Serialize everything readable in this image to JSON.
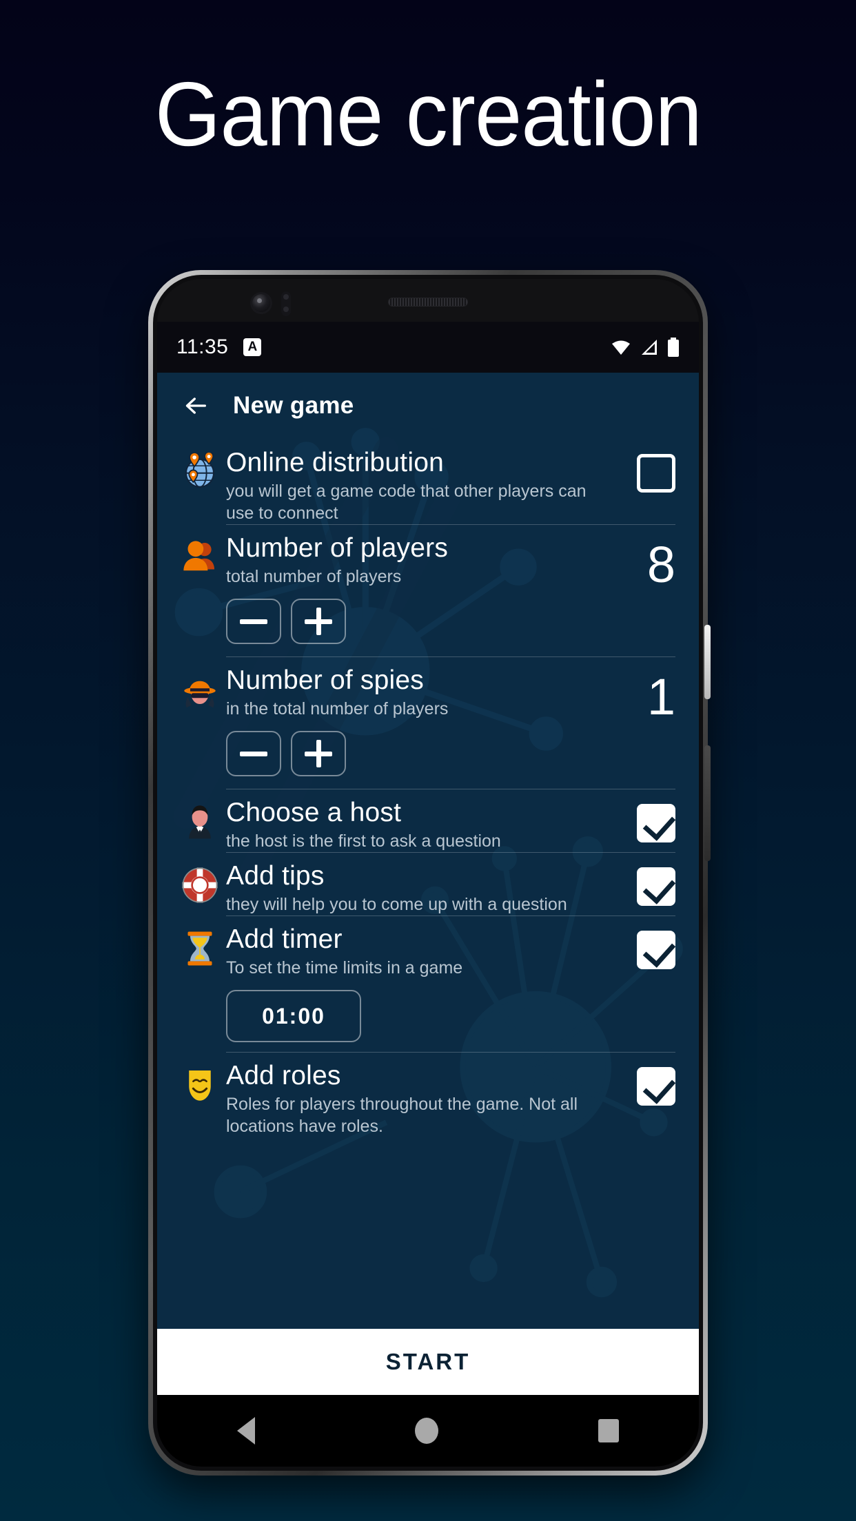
{
  "hero": {
    "title": "Game creation"
  },
  "status_bar": {
    "time": "11:35",
    "notification_badge": "A",
    "icons": [
      "wifi-icon",
      "cellular-signal-icon",
      "battery-icon"
    ]
  },
  "app_bar": {
    "back_icon": "back-arrow-icon",
    "title": "New game"
  },
  "settings": [
    {
      "id": "online-distribution",
      "icon": "globe-pins-icon",
      "title": "Online distribution",
      "subtitle": "you will get a game code that other players can use to connect",
      "control": "checkbox",
      "checked": false
    },
    {
      "id": "number-of-players",
      "icon": "people-icon",
      "title": "Number of players",
      "subtitle": "total number of players",
      "control": "stepper",
      "value": "8",
      "minus_label": "−",
      "plus_label": "+"
    },
    {
      "id": "number-of-spies",
      "icon": "spy-icon",
      "title": "Number of spies",
      "subtitle": "in the total number of players",
      "control": "stepper",
      "value": "1",
      "minus_label": "−",
      "plus_label": "+"
    },
    {
      "id": "choose-a-host",
      "icon": "man-in-suit-icon",
      "title": "Choose a host",
      "subtitle": "the host is the first to ask a question",
      "control": "checkbox",
      "checked": true
    },
    {
      "id": "add-tips",
      "icon": "life-ring-icon",
      "title": "Add tips",
      "subtitle": "they will help you to come up with a question",
      "control": "checkbox",
      "checked": true
    },
    {
      "id": "add-timer",
      "icon": "hourglass-icon",
      "title": "Add timer",
      "subtitle": "To set the time limits in a game",
      "control": "checkbox",
      "checked": true,
      "timer_value": "01:00"
    },
    {
      "id": "add-roles",
      "icon": "theater-mask-icon",
      "title": "Add roles",
      "subtitle": "Roles for players throughout the game. Not all locations have roles.",
      "control": "checkbox",
      "checked": true
    }
  ],
  "start_button": {
    "label": "START"
  },
  "nav_bar": {
    "back": "nav-back-icon",
    "home": "nav-home-icon",
    "recents": "nav-recents-icon"
  },
  "colors": {
    "page_gradient_top": "#030318",
    "page_gradient_bottom": "#002a3f",
    "app_background": "#0b2b44",
    "accent_orange": "#f07800",
    "text_primary": "#ffffff",
    "text_secondary": "#b9c6d1",
    "start_button_bg": "#ffffff",
    "start_button_text": "#0b2234"
  }
}
